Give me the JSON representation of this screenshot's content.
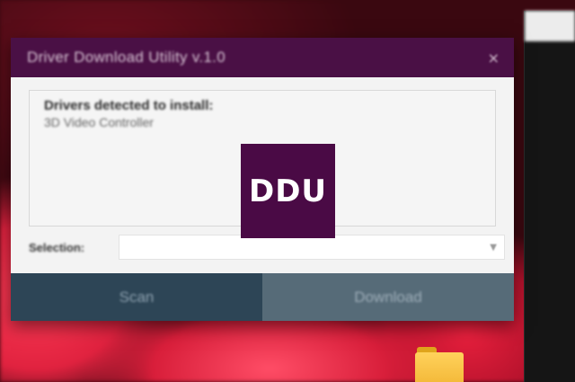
{
  "window": {
    "title": "Driver Download Utility v.1.0",
    "close_glyph": "×"
  },
  "panel": {
    "heading": "Drivers detected to install:",
    "items": [
      "3D Video Controller"
    ]
  },
  "selection": {
    "label": "Selection:",
    "value": "",
    "dropdown_glyph": "▼"
  },
  "buttons": {
    "scan": "Scan",
    "download": "Download"
  },
  "logo": {
    "text": "DDU"
  },
  "colors": {
    "titlebar": "#4a1045",
    "scan_button": "#2d4556",
    "download_button": "#566b78",
    "logo_bg": "#4a0a45"
  },
  "icons": [
    "close-icon",
    "chevron-down-icon",
    "folder-icon"
  ]
}
